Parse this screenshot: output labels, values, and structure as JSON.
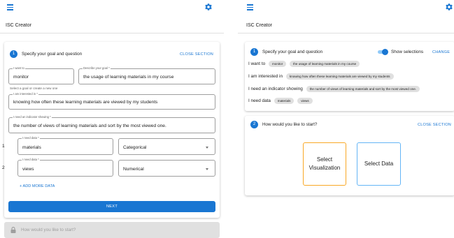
{
  "colors": {
    "primary": "#1976d2",
    "option_vis_border": "#f9a825",
    "option_data_border": "#64b5f6",
    "disabled_bg": "#e0e0e0"
  },
  "icons": {
    "menu": "menu-icon",
    "settings": "gear-icon",
    "lock": "lock-icon"
  },
  "left": {
    "title": "ISC Creator",
    "step1": {
      "number": "1",
      "title": "Specify your goal and question",
      "close_label": "CLOSE SECTION",
      "want_label": "I want to",
      "want_value": "monitor",
      "goal_label": "Describe your goal *",
      "goal_value": "the usage of learning materials in my course",
      "goal_helper": "Select a goal or create a new one",
      "interest_label": "I am interested in *",
      "interest_value": "knowing how often these learning materials are viewed by my students",
      "indicator_label": "I need an indicator showing *",
      "indicator_value": "the number of views of learning materials and sort by the most viewed one.",
      "data_rows": [
        {
          "index": "1",
          "label": "I need data *",
          "value": "materials",
          "type": "Categorical"
        },
        {
          "index": "2",
          "label": "I need data *",
          "value": "views",
          "type": "Numerical"
        }
      ],
      "add_more_label": "+ ADD MORE DATA",
      "next_label": "NEXT"
    },
    "step2_disabled": "How would you like to start?"
  },
  "right": {
    "title": "ISC Creator",
    "step1": {
      "number": "1",
      "title": "Specify your goal and question",
      "toggle_label": "Show selections",
      "toggle_on": true,
      "change_label": "CHANGE",
      "want_prefix": "I want to",
      "want_chips": [
        "monitor",
        "the usage of learning materials in my course"
      ],
      "interest_prefix": "I am interested in",
      "interest_chips": [
        "knowing how often these learning materials are viewed by my students"
      ],
      "indicator_prefix": "I need an indicator showing",
      "indicator_chips": [
        "the number of views of learning materials and sort by the most viewed one."
      ],
      "data_prefix": "I need data",
      "data_chips": [
        "materials",
        "views"
      ]
    },
    "step2": {
      "number": "2",
      "title": "How would you like to start?",
      "close_label": "CLOSE SECTION",
      "option_visualization": "Select Visualization",
      "option_data": "Select Data"
    }
  }
}
